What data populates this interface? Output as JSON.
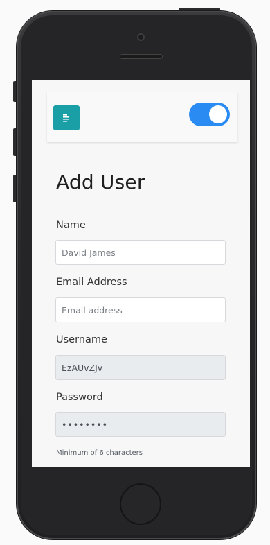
{
  "app": {
    "title": "Add User",
    "theme_toggle_on": true,
    "accent_color": "#1a9fa6",
    "toggle_color": "#2a8bf2"
  },
  "icons": {
    "menu": "menu-icon"
  },
  "form": {
    "name": {
      "label": "Name",
      "placeholder": "David James",
      "value": ""
    },
    "email": {
      "label": "Email Address",
      "placeholder": "Email address",
      "value": ""
    },
    "username": {
      "label": "Username",
      "value": "EzAUvZJv"
    },
    "password": {
      "label": "Password",
      "value": "••••••••"
    },
    "password_help": "Minimum of 6 characters"
  }
}
